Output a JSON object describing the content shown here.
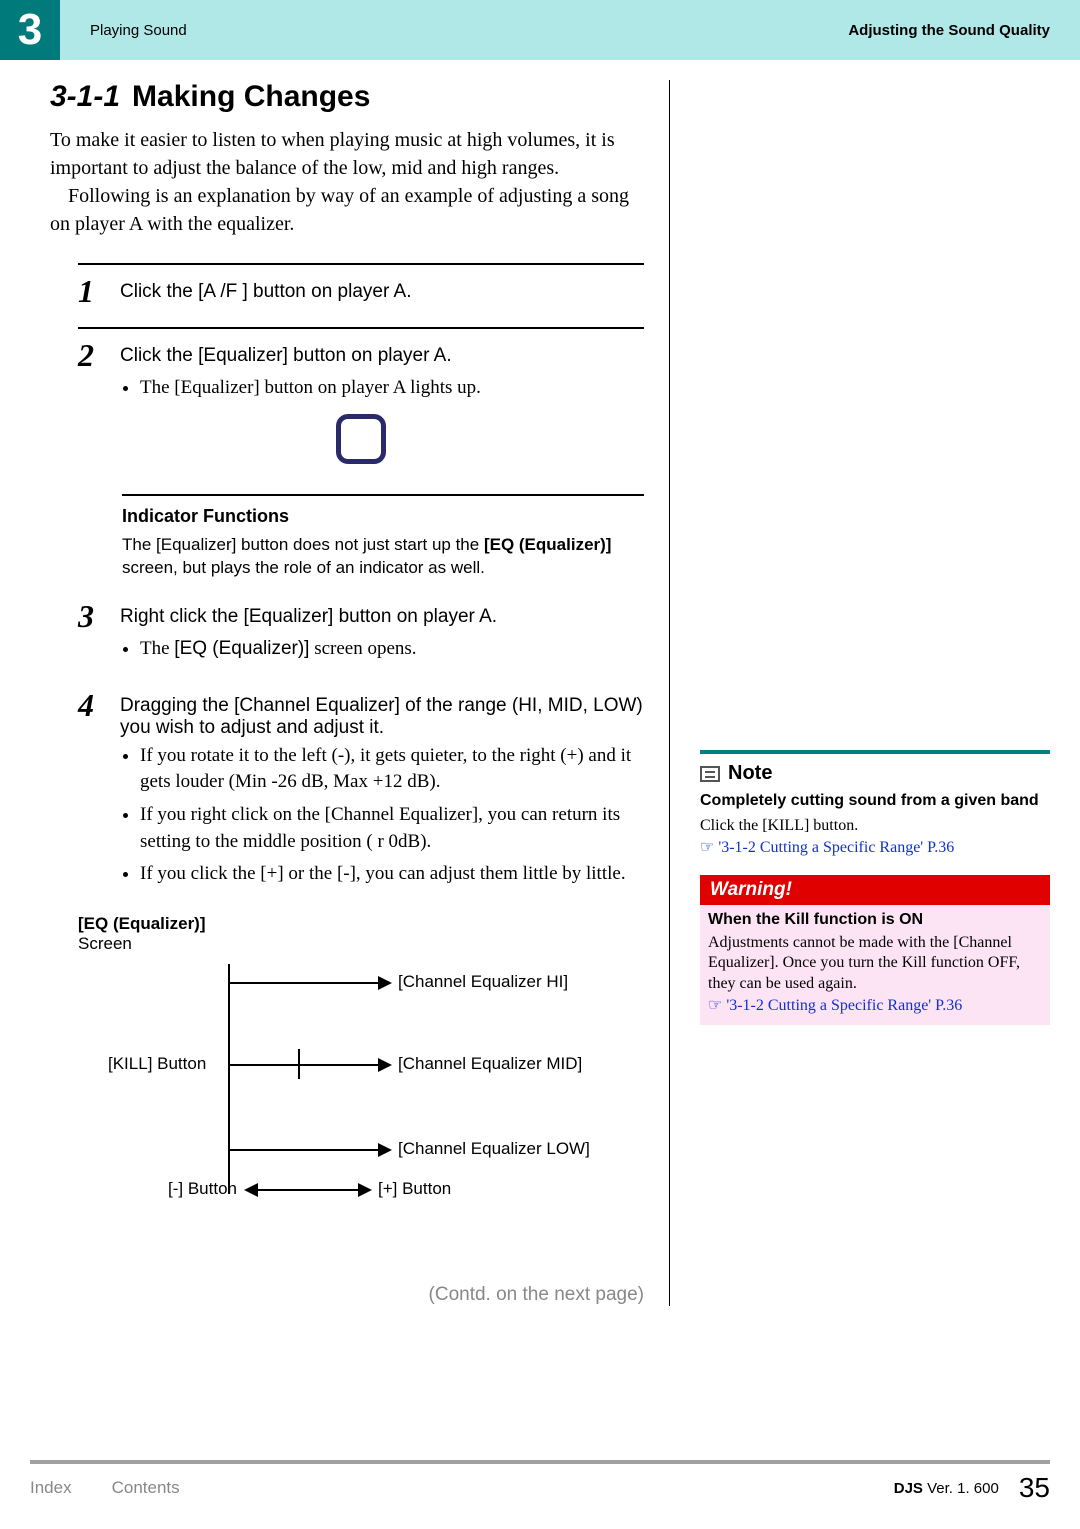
{
  "header": {
    "chapter_num": "3",
    "breadcrumb_left": "Playing Sound",
    "breadcrumb_right": "Adjusting the Sound Quality"
  },
  "section": {
    "number": "3-1-1",
    "title": "Making Changes",
    "intro": "To make it easier to listen to when playing music at high volumes, it is important to adjust the balance of the low, mid and high ranges.",
    "intro2": "Following is an explanation by way of an example of adjusting a song on player A with the equalizer."
  },
  "steps": [
    {
      "num": "1",
      "title": "Click the [A /F ] button on player A."
    },
    {
      "num": "2",
      "title": "Click the [Equalizer] button on player A.",
      "subs": [
        "The [Equalizer] button on player A lights up."
      ]
    }
  ],
  "indicator": {
    "heading": "Indicator Functions",
    "text_a": "The [Equalizer] button does not just start up the ",
    "text_b": "[EQ (Equalizer)]",
    "text_c": " screen, but plays the role of an indicator as well."
  },
  "steps2": [
    {
      "num": "3",
      "title": "Right click the [Equalizer] button on player A.",
      "subs_html": [
        {
          "prefix": "The ",
          "code": "[EQ (Equalizer)]",
          "suffix": " screen opens."
        }
      ]
    },
    {
      "num": "4",
      "title": "Dragging the [Channel Equalizer] of the range (HI, MID, LOW) you wish to adjust and adjust it.",
      "subs": [
        "If you rotate it to the left (-), it gets quieter, to the right (+) and it gets louder (Min -26 dB, Max +12 dB).",
        "If you right click on the [Channel Equalizer], you can return its setting to the middle position ( r 0dB).",
        "If you click the [+] or the [-], you can adjust them little by little."
      ]
    }
  ],
  "eq_screen": {
    "label": "[EQ (Equalizer)]",
    "sublabel": "Screen"
  },
  "diagram": {
    "ch_hi": "[Channel Equalizer HI]",
    "ch_mid": "[Channel Equalizer MID]",
    "ch_low": "[Channel Equalizer LOW]",
    "kill": "[KILL] Button",
    "minus": "[-] Button",
    "plus": "[+] Button"
  },
  "contd": "(Contd. on the next page)",
  "note": {
    "heading": "Note",
    "sub": "Completely cutting sound from a given band",
    "body": "Click the [KILL] button.",
    "link": "'3-1-2 Cutting a Specific Range' P.36"
  },
  "warning": {
    "heading": "Warning!",
    "sub": "When the Kill function is ON",
    "body": "Adjustments cannot be made with the [Channel Equalizer]. Once you turn the Kill function OFF, they can be used again.",
    "link": "'3-1-2 Cutting a Specific Range' P.36"
  },
  "footer": {
    "index": "Index",
    "contents": "Contents",
    "product": "DJS",
    "ver_label": " Ver. 1. 600",
    "page": "35"
  }
}
